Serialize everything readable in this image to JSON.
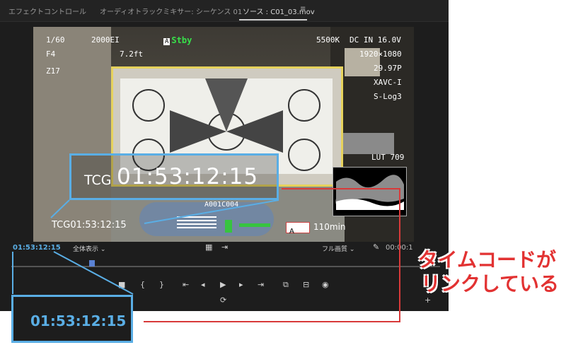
{
  "tabs": [
    "エフェクトコントロール",
    "オーディオトラックミキサー: シーケンス 01",
    "ソース : C01_03.mov"
  ],
  "menu_icon": "hamburger-icon",
  "osd": {
    "shutter": "1/60",
    "iris": "F4",
    "zoom": "Z17",
    "iso": "2000EI",
    "focus": "7.2ft",
    "stby": "Stby",
    "stby_badge": "A",
    "wb": "5500K",
    "dc": "DC IN 16.0V",
    "resolution": "1920×1080",
    "fps": "29.97P",
    "codec": "XAVC-I",
    "gamma": "S-Log3",
    "lut": "LUT 709",
    "clip": "A001C004",
    "tc_prefix": "TCG",
    "tc": "01:53:12:15",
    "media_slot": "A",
    "remain": "110min"
  },
  "controls": {
    "timecode": "01:53:12:15",
    "zoom_label": "全体表示",
    "quality": "フル画質",
    "duration": "00:00:1"
  },
  "callout_tc": "01:53:12:15",
  "annotation": [
    "タイムコードが",
    "リンクしている"
  ],
  "colors": {
    "accent": "#5aaee5",
    "annotation": "#e23232",
    "stby": "#38e04a"
  }
}
